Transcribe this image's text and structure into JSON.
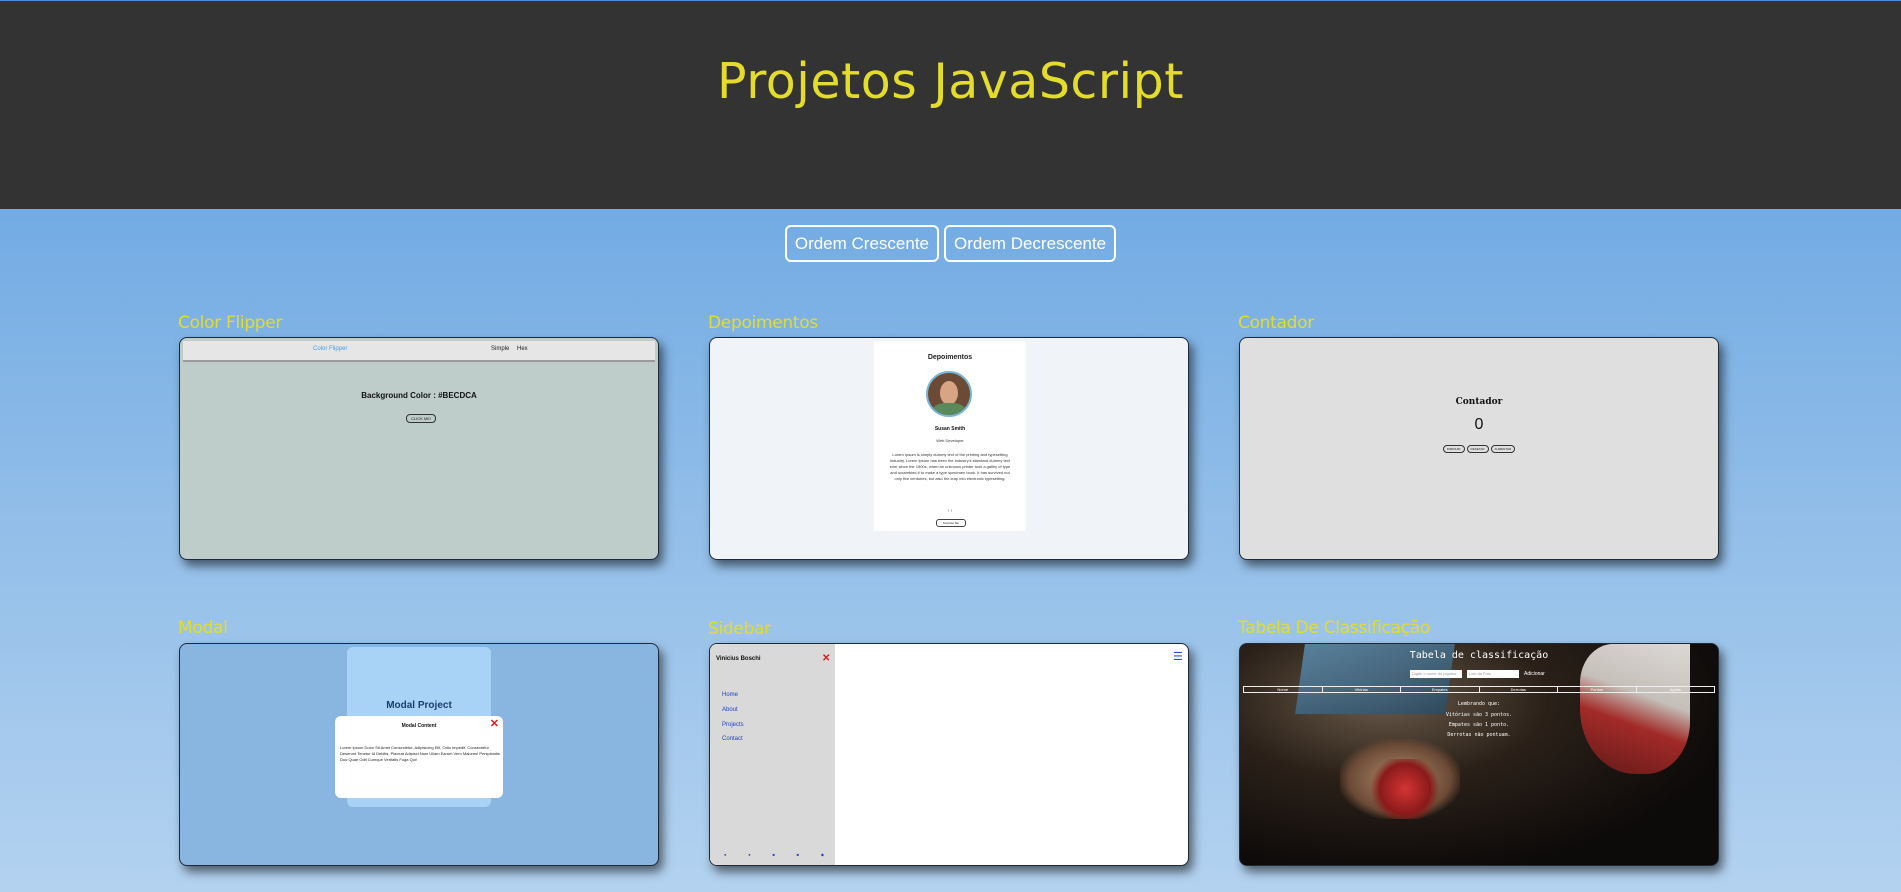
{
  "header": {
    "title": "Projetos JavaScript"
  },
  "sort": {
    "asc_label": "Ordem Crescente",
    "desc_label": "Ordem Decrescente"
  },
  "projects": [
    {
      "title": "Color Flipper"
    },
    {
      "title": "Depoimentos"
    },
    {
      "title": "Contador"
    },
    {
      "title": "Modal"
    },
    {
      "title": "Sidebar"
    },
    {
      "title": "Tabela De Classificação"
    }
  ],
  "color_flipper": {
    "brand": "Color Flipper",
    "nav_links": [
      "Simple",
      "Hex"
    ],
    "text": "Background Color : #BECDCA",
    "button": "CLICK ME!"
  },
  "depoimentos": {
    "title": "Depoimentos",
    "name": "Susan Smith",
    "job": "Web Developer",
    "text": "Lorem Ipsum is simply dummy text of the printing and typesetting industry. Lorem Ipsum has been the industry's standard dummy text ever since the 1500s, when an unknown printer took a galley of type and scrambled it to make a type specimen book. It has survived not only five centuries, but also the leap into electronic typesetting.",
    "arrows": "‹   ›",
    "button": "Surprise Me"
  },
  "contador": {
    "title": "Contador",
    "count": "0",
    "buttons": [
      "DIMINUIR",
      "RESETAR",
      "AUMENTAR"
    ]
  },
  "modal": {
    "title": "Modal Project",
    "close": "✕",
    "content_title": "Modal Content",
    "text": "Lorem Ipsum Dolor Sit Amet Consectetur, Adipisicing Elit. Odio Impedit, Consectetur Deserunt Tenetur Id Debitis, Placeat Adipisci Nam Ullam Earum Vero Maiores! Perspiciatis Duo Quae Odit Cumque Veritatis Fuga Qui!"
  },
  "sidebar": {
    "brand": "Vinicius Boschi",
    "close": "✕",
    "links": [
      "Home",
      "About",
      "Projects",
      "Contact"
    ],
    "menu_icon": "☰",
    "social_icons": [
      "facebook-icon",
      "twitter-icon",
      "behance-icon",
      "linkedin-icon",
      "sketch-icon"
    ]
  },
  "tabela": {
    "title": "Tabela de classificação",
    "input_player_placeholder": "Digite o nome do jogador",
    "input_url_placeholder": "Link da Foto",
    "add_button": "Adicionar",
    "columns": [
      "Nome",
      "Vitórias",
      "Empates",
      "Derrotas",
      "Pontos",
      "Ações"
    ],
    "messages": [
      "Lembrando que:",
      "Vitórias são 3 pontos.",
      "Empates são 1 ponto.",
      "Derrotas não pontuam."
    ]
  },
  "colors": {
    "header_bg": "#333333",
    "title_yellow": "#e4dc2a",
    "page_bg_top": "#5d9ee0",
    "page_bg_bottom": "#b3d2f0"
  }
}
